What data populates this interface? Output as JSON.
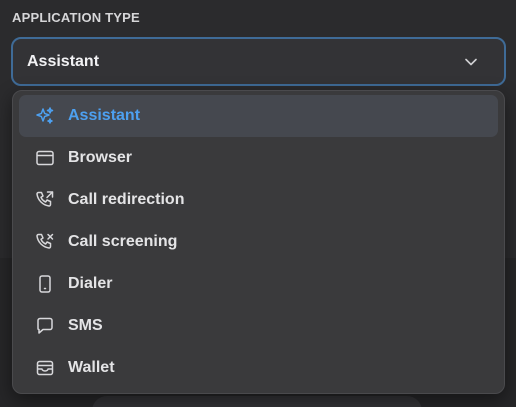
{
  "section": {
    "label": "APPLICATION TYPE"
  },
  "select": {
    "value": "Assistant",
    "icon": "chevron-down-icon"
  },
  "menu": {
    "items": [
      {
        "label": "Assistant",
        "icon": "sparkles-icon",
        "selected": true
      },
      {
        "label": "Browser",
        "icon": "browser-window-icon",
        "selected": false
      },
      {
        "label": "Call redirection",
        "icon": "phone-forward-icon",
        "selected": false
      },
      {
        "label": "Call screening",
        "icon": "phone-x-icon",
        "selected": false
      },
      {
        "label": "Dialer",
        "icon": "smartphone-icon",
        "selected": false
      },
      {
        "label": "SMS",
        "icon": "message-bubble-icon",
        "selected": false
      },
      {
        "label": "Wallet",
        "icon": "wallet-icon",
        "selected": false
      }
    ]
  },
  "colors": {
    "accent": "#4da0f0",
    "focus_border": "#3f6b97",
    "menu_background": "#3a3a3c",
    "page_background": "#2b2b2d"
  }
}
